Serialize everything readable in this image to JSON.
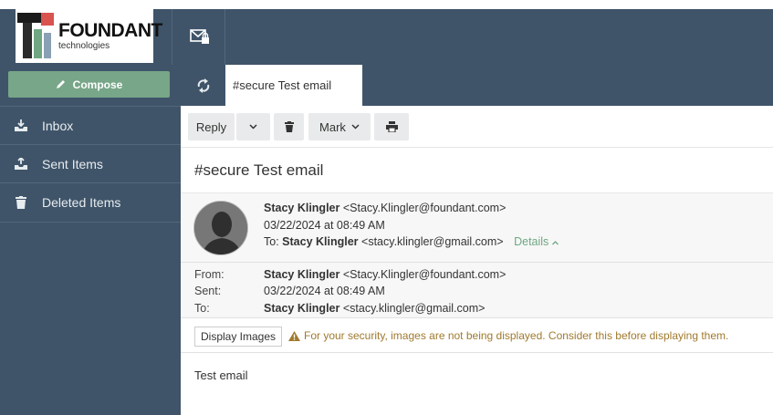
{
  "brand": {
    "name": "FOUNDANT",
    "sub": "technologies"
  },
  "sidebar": {
    "compose_label": "Compose",
    "items": [
      {
        "label": "Inbox",
        "icon": "inbox-icon"
      },
      {
        "label": "Sent Items",
        "icon": "sent-icon"
      },
      {
        "label": "Deleted Items",
        "icon": "trash-icon"
      }
    ]
  },
  "tab": {
    "label": "#secure Test email"
  },
  "toolbar": {
    "reply_label": "Reply",
    "mark_label": "Mark"
  },
  "message": {
    "subject": "#secure Test email",
    "from_name": "Stacy Klingler",
    "from_addr": "<Stacy.Klingler@foundant.com>",
    "date": "03/22/2024 at 08:49 AM",
    "to_prefix": "To:",
    "to_name": "Stacy Klingler",
    "to_addr": "<stacy.klingler@gmail.com>",
    "details_label": "Details",
    "body": "Test email"
  },
  "meta": {
    "from_label": "From:",
    "sent_label": "Sent:",
    "to_label": "To:"
  },
  "security": {
    "display_images_label": "Display Images",
    "warning": "For your security, images are not being displayed. Consider this before displaying them."
  },
  "colors": {
    "sidebar": "#3f5469",
    "accent": "#77a688",
    "warning": "#a07a2e"
  }
}
